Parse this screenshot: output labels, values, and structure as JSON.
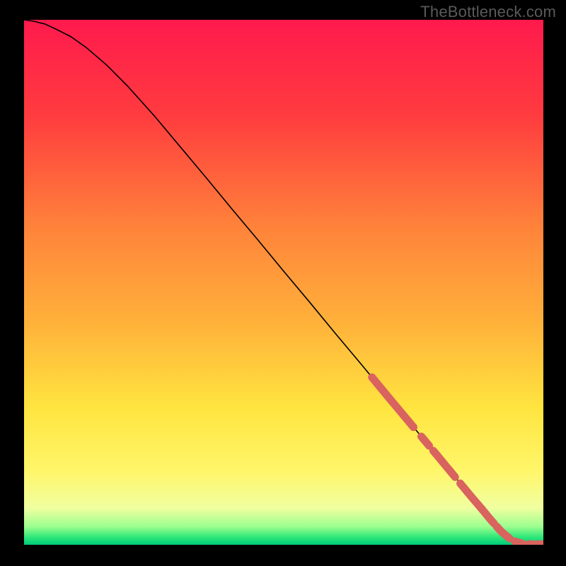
{
  "watermark": "TheBottleneck.com",
  "colors": {
    "curve_stroke": "#000000",
    "highlight": "#d9635e",
    "gradient_stops": [
      {
        "offset": 0.0,
        "color": "#ff1a4d"
      },
      {
        "offset": 0.18,
        "color": "#ff3b3f"
      },
      {
        "offset": 0.4,
        "color": "#ff843a"
      },
      {
        "offset": 0.58,
        "color": "#ffb23a"
      },
      {
        "offset": 0.74,
        "color": "#ffe540"
      },
      {
        "offset": 0.86,
        "color": "#fff66a"
      },
      {
        "offset": 0.93,
        "color": "#f0ffa0"
      },
      {
        "offset": 0.965,
        "color": "#9dff8f"
      },
      {
        "offset": 0.985,
        "color": "#30e879"
      },
      {
        "offset": 1.0,
        "color": "#00c97a"
      }
    ]
  },
  "chart_data": {
    "type": "line",
    "title": "",
    "xlabel": "",
    "ylabel": "",
    "xlim": [
      0,
      100
    ],
    "ylim": [
      0,
      100
    ],
    "x": [
      0,
      2,
      4,
      6,
      9,
      12,
      16,
      20,
      25,
      30,
      35,
      40,
      45,
      50,
      55,
      60,
      65,
      70,
      75,
      80,
      82,
      84,
      86,
      88,
      90,
      92,
      94,
      96,
      98,
      100
    ],
    "values": [
      100.0,
      99.7,
      99.2,
      98.3,
      96.8,
      94.7,
      91.3,
      87.3,
      81.8,
      75.9,
      70.0,
      64.0,
      58.1,
      52.1,
      46.2,
      40.2,
      34.3,
      28.3,
      22.4,
      16.5,
      14.1,
      11.7,
      9.3,
      7.0,
      4.6,
      2.4,
      0.8,
      0.2,
      0.1,
      0.1
    ],
    "highlight_segments": [
      {
        "x0": 67,
        "x1": 75
      },
      {
        "x0": 76.5,
        "x1": 78
      },
      {
        "x0": 78.8,
        "x1": 83
      },
      {
        "x0": 84,
        "x1": 90.5
      },
      {
        "x0": 91,
        "x1": 93.5
      },
      {
        "x0": 94.5,
        "x1": 96
      },
      {
        "x0": 97.2,
        "x1": 98
      },
      {
        "x0": 98.8,
        "x1": 100
      }
    ],
    "highlight_thickness_px": 11
  }
}
